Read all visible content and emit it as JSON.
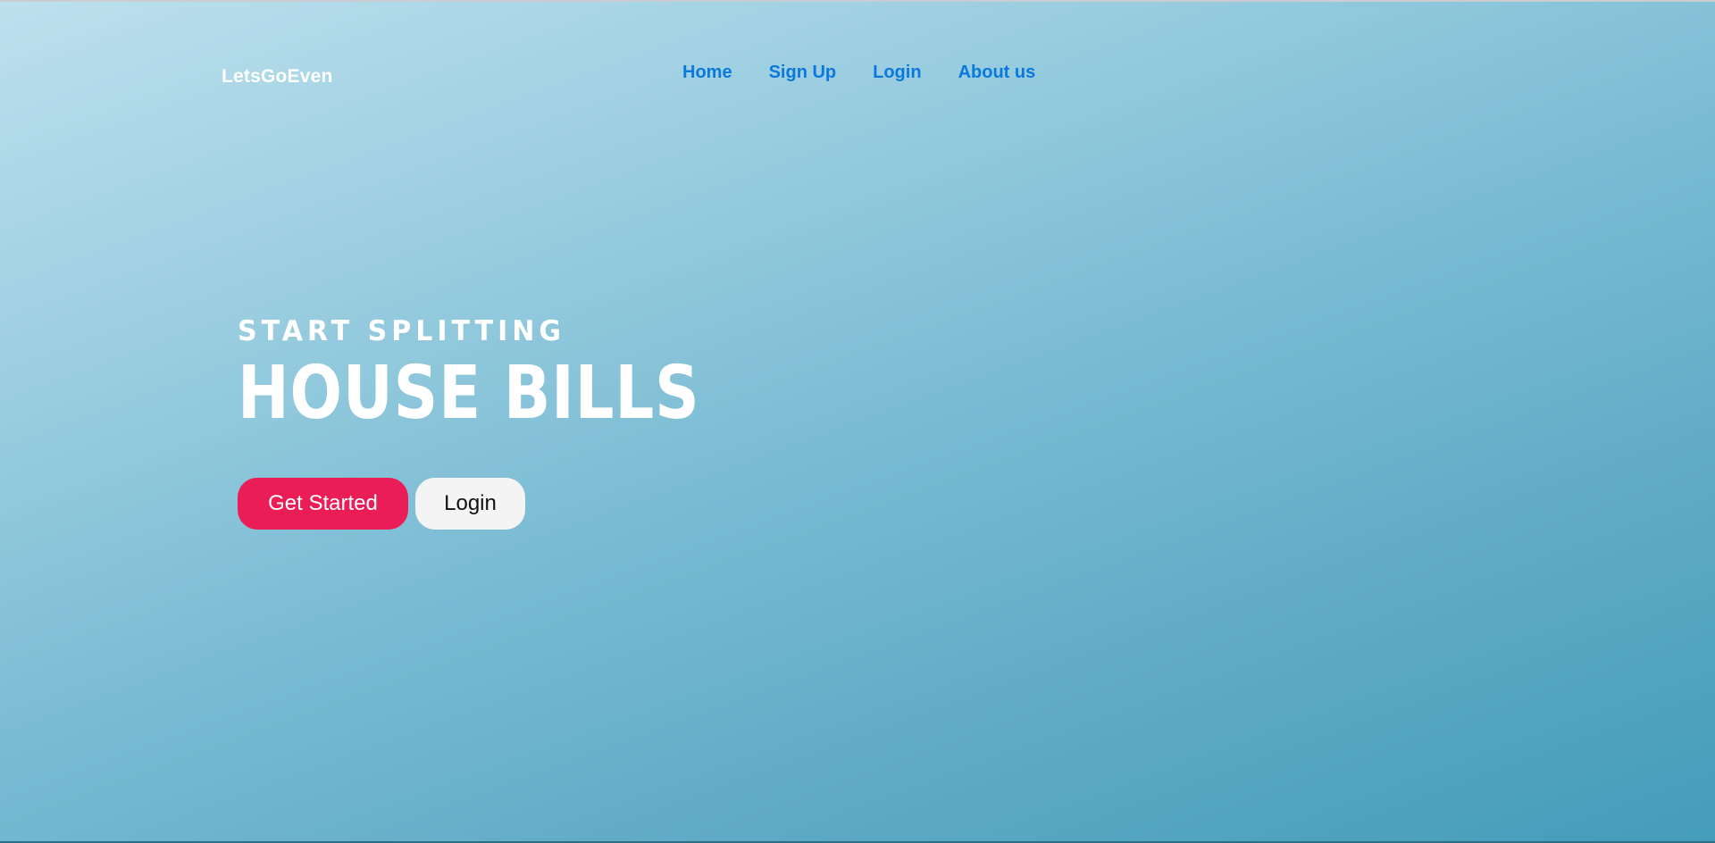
{
  "header": {
    "brand": "LetsGoEven",
    "nav": {
      "home": "Home",
      "signup": "Sign Up",
      "login": "Login",
      "about": "About us"
    }
  },
  "hero": {
    "subtitle": "START SPLITTING",
    "title": "HOUSE BILLS",
    "buttons": {
      "primary": "Get Started",
      "secondary": "Login"
    }
  },
  "colors": {
    "nav_link": "#0a78dc",
    "primary_button": "#ea1d56",
    "secondary_button": "#f4f4f4",
    "background_start": "#bde0ee",
    "background_end": "#449db9"
  }
}
